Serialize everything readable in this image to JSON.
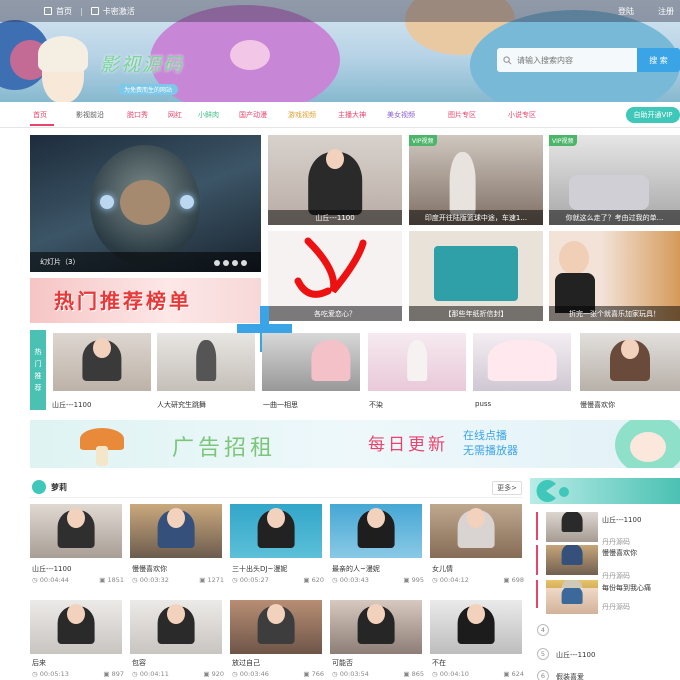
{
  "topbar": {
    "home": "首页",
    "card_activation": "卡密激活",
    "login": "登陆",
    "register": "注册"
  },
  "logo": {
    "text": "影视源码",
    "tag": "为免费而生的网站"
  },
  "search": {
    "placeholder": "请输入搜索内容",
    "button": "搜 索"
  },
  "nav": {
    "items": [
      "首页",
      "影视前沿",
      "脱口秀",
      "网红",
      "小鲜肉",
      "国产动漫",
      "游戏视频",
      "主播大神",
      "美女视频",
      "图片专区",
      "小说专区"
    ],
    "button": "自助开通VIP"
  },
  "slider": {
    "caption": "幻灯片（3）"
  },
  "featured": [
    {
      "caption": "山丘---1100",
      "vip": ""
    },
    {
      "caption": "印度开往陆版篮球中途，车速1...",
      "vip": "VIP视频"
    },
    {
      "caption": "你就这么走了？考由过我的单...",
      "vip": "VIP视频"
    },
    {
      "caption": "各吃爱恋心？",
      "vip": ""
    },
    {
      "caption": "【那些年纸折信封】",
      "vip": ""
    },
    {
      "caption": "折完一张个就喜乐加家玩具！",
      "vip": ""
    }
  ],
  "hot": {
    "banner": "热门推荐榜单",
    "side_label": [
      "热",
      "门",
      "推",
      "荐"
    ],
    "items": [
      "山丘---1100",
      "人大研究生跳舞",
      "一曲一相思",
      "不染",
      "puss",
      "慢慢喜欢你"
    ]
  },
  "ad": {
    "line1": "广告招租",
    "line2": "每日更新",
    "line3a": "在线点播",
    "line3b": "无需播放器"
  },
  "section": {
    "title": "萝莉",
    "more": "更多>",
    "cards": [
      {
        "title": "山丘---1100",
        "duration": "00:04:44",
        "views": "1851"
      },
      {
        "title": "慢慢喜欢你",
        "duration": "00:03:32",
        "views": "1271"
      },
      {
        "title": "三十出头DJ~漫妮",
        "duration": "00:05:27",
        "views": "620"
      },
      {
        "title": "最亲的人~漫妮",
        "duration": "00:03:43",
        "views": "995"
      },
      {
        "title": "女儿情",
        "duration": "00:04:12",
        "views": "698"
      },
      {
        "title": "后来",
        "duration": "00:05:13",
        "views": "897"
      },
      {
        "title": "包容",
        "duration": "00:04:11",
        "views": "920"
      },
      {
        "title": "放过自己",
        "duration": "00:03:46",
        "views": "766"
      },
      {
        "title": "可能否",
        "duration": "00:03:54",
        "views": "865"
      },
      {
        "title": "不在",
        "duration": "00:04:10",
        "views": "624"
      }
    ]
  },
  "ranking": {
    "thumb_items": [
      {
        "title": "山丘---1100",
        "sub": ""
      },
      {
        "title": "慢慢喜欢你",
        "sub": "丹丹源码"
      },
      {
        "title": "每份每到我心痛",
        "sub": "丹丹源码"
      },
      {
        "title": "",
        "sub": "丹丹源码"
      }
    ],
    "list": [
      {
        "num": "4",
        "title": ""
      },
      {
        "num": "5",
        "title": "山丘---1100"
      },
      {
        "num": "6",
        "title": "假装喜爱"
      }
    ]
  },
  "colors": {
    "accent": "#e8446c",
    "teal": "#3fc7b9",
    "blue": "#3aa4e6"
  }
}
